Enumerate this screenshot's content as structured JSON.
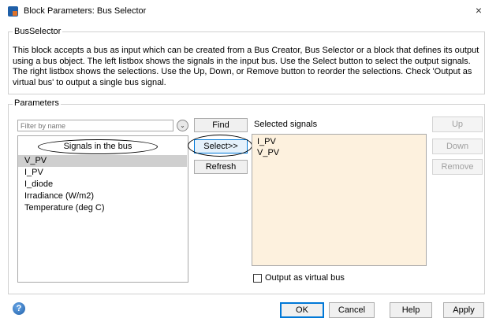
{
  "window": {
    "title": "Block Parameters: Bus Selector",
    "close_glyph": "×"
  },
  "block_group": {
    "label": "BusSelector",
    "description": "This block accepts a bus as input which can be created from a Bus Creator, Bus Selector or a block that defines its output using a bus object. The left listbox shows the signals in the input bus. Use the Select button to select the output signals. The right listbox shows the selections. Use the Up, Down, or Remove button to reorder the selections. Check 'Output as virtual bus' to output a single bus signal."
  },
  "parameters": {
    "label": "Parameters",
    "filter_placeholder": "Filter by name",
    "signals_header": "Signals in the bus",
    "signals": [
      "V_PV",
      "I_PV",
      "I_diode",
      "Irradiance (W/m2)",
      "Temperature (deg C)"
    ],
    "selected_signal_index": 0,
    "find_label": "Find",
    "select_label": "Select>>",
    "refresh_label": "Refresh",
    "selected_signals_label": "Selected signals",
    "selected_signals": [
      "I_PV",
      "V_PV"
    ],
    "up_label": "Up",
    "down_label": "Down",
    "remove_label": "Remove",
    "virtual_bus_label": "Output as virtual bus",
    "virtual_bus_checked": false
  },
  "footer": {
    "help_icon_glyph": "?",
    "ok_label": "OK",
    "cancel_label": "Cancel",
    "help_label": "Help",
    "apply_label": "Apply"
  },
  "colors": {
    "selected_list_bg": "#fdf1de",
    "row_highlight": "#cfcfcf",
    "accent_border": "#0078d7"
  }
}
